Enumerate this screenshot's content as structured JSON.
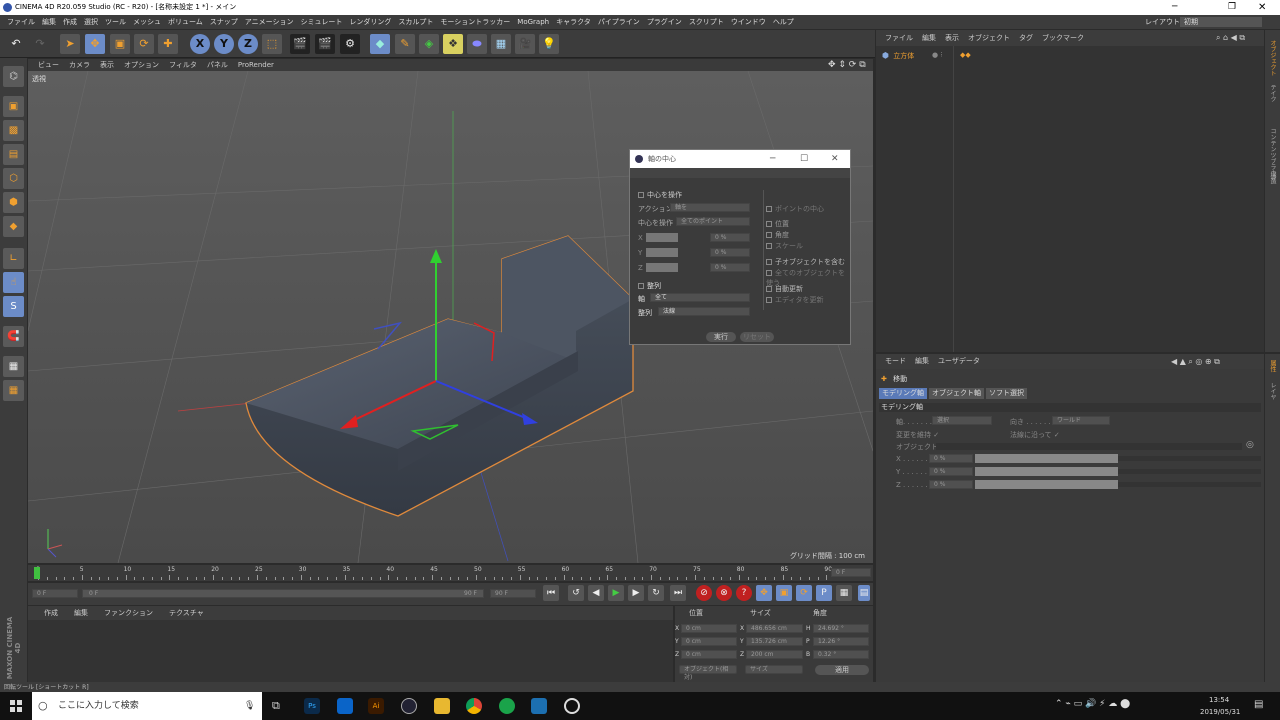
{
  "window": {
    "title": "CINEMA 4D R20.059 Studio (RC - R20) - [名称未設定 1 *] - メイン",
    "layout_label": "レイアウト:",
    "layout_value": "初期"
  },
  "menu": [
    "ファイル",
    "編集",
    "作成",
    "選択",
    "ツール",
    "メッシュ",
    "ボリューム",
    "スナップ",
    "アニメーション",
    "シミュレート",
    "レンダリング",
    "スカルプト",
    "モーショントラッカー",
    "MoGraph",
    "キャラクタ",
    "パイプライン",
    "プラグイン",
    "スクリプト",
    "ウインドウ",
    "ヘルプ"
  ],
  "toolbar": {
    "axis_x": "X",
    "axis_y": "Y",
    "axis_z": "Z"
  },
  "viewport": {
    "menu": [
      "ビュー",
      "カメラ",
      "表示",
      "オプション",
      "フィルタ",
      "パネル",
      "ProRender"
    ],
    "view_name": "透視",
    "grid_label": "グリッド間隔 : 100 cm"
  },
  "object_manager": {
    "menu": [
      "ファイル",
      "編集",
      "表示",
      "オブジェクト",
      "タグ",
      "ブックマーク"
    ],
    "object_name": "立方体"
  },
  "right_tabs": [
    "オブジェクト",
    "テイク",
    "コンテンツブラウザ",
    "構造"
  ],
  "attr_tabs": [
    "属性",
    "レイヤ"
  ],
  "dialog": {
    "title": "軸の中心",
    "center_op": "中心を操作",
    "action_label": "アクション",
    "action_value": "軸を",
    "center_label": "中心を操作",
    "center_value": "全てのポイント",
    "x": "X",
    "y": "Y",
    "z": "Z",
    "pct": "0 %",
    "align": "整列",
    "axis_label": "軸",
    "axis_value": "全て",
    "align_label": "整列",
    "align_value": "法線",
    "point_center": "ポイントの中心",
    "position": "位置",
    "rotation": "角度",
    "scale": "スケール",
    "include_children": "子オブジェクトを含む",
    "use_all": "全てのオブジェクトを使う",
    "auto_update": "自動更新",
    "editor_update": "エディタを更新",
    "execute": "実行",
    "reset": "リセット"
  },
  "attributes": {
    "menu": [
      "モード",
      "編集",
      "ユーザデータ"
    ],
    "tool_name": "移動",
    "tabs": [
      "モデリング軸",
      "オブジェクト軸",
      "ソフト選択"
    ],
    "section": "モデリング軸",
    "axis_label": "軸. . . . . . .",
    "axis_value": "選択",
    "orient_label": "向き . . . . . .",
    "orient_value": "ワールド",
    "keep_label": "変更を維持 ✓",
    "along_label": "法線に沿って ✓",
    "object_label": "オブジェクト",
    "x_label": "X . . . . . .",
    "y_label": "Y . . . . . .",
    "z_label": "Z . . . . . .",
    "pct": "0 %"
  },
  "timeline": {
    "ticks": [
      "0",
      "5",
      "10",
      "15",
      "20",
      "25",
      "30",
      "35",
      "40",
      "45",
      "50",
      "55",
      "60",
      "65",
      "70",
      "75",
      "80",
      "85",
      "90"
    ],
    "current": "0 F",
    "start": "0 F",
    "slider_left": "0 F",
    "slider_right": "90 F",
    "end": "90 F"
  },
  "material": {
    "menu": [
      "作成",
      "編集",
      "ファンクション",
      "テクスチャ"
    ]
  },
  "coords": {
    "h_pos": "位置",
    "h_size": "サイズ",
    "h_rot": "角度",
    "rows": [
      {
        "a": "X",
        "pos": "0 cm",
        "b": "X",
        "size": "486.656 cm",
        "c": "H",
        "rot": "24.692 °"
      },
      {
        "a": "Y",
        "pos": "0 cm",
        "b": "Y",
        "size": "135.726 cm",
        "c": "P",
        "rot": "12.26 °"
      },
      {
        "a": "Z",
        "pos": "0 cm",
        "b": "Z",
        "size": "200 cm",
        "c": "B",
        "rot": "0.32 °"
      }
    ],
    "mode": "オブジェクト(相対)",
    "size_mode": "サイズ",
    "apply": "適用"
  },
  "status": "回転ツール [ショートカット R]",
  "logo": "MAXON CINEMA 4D",
  "taskbar": {
    "search": "ここに入力して検索",
    "time": "13:54",
    "date": "2019/05/31"
  }
}
